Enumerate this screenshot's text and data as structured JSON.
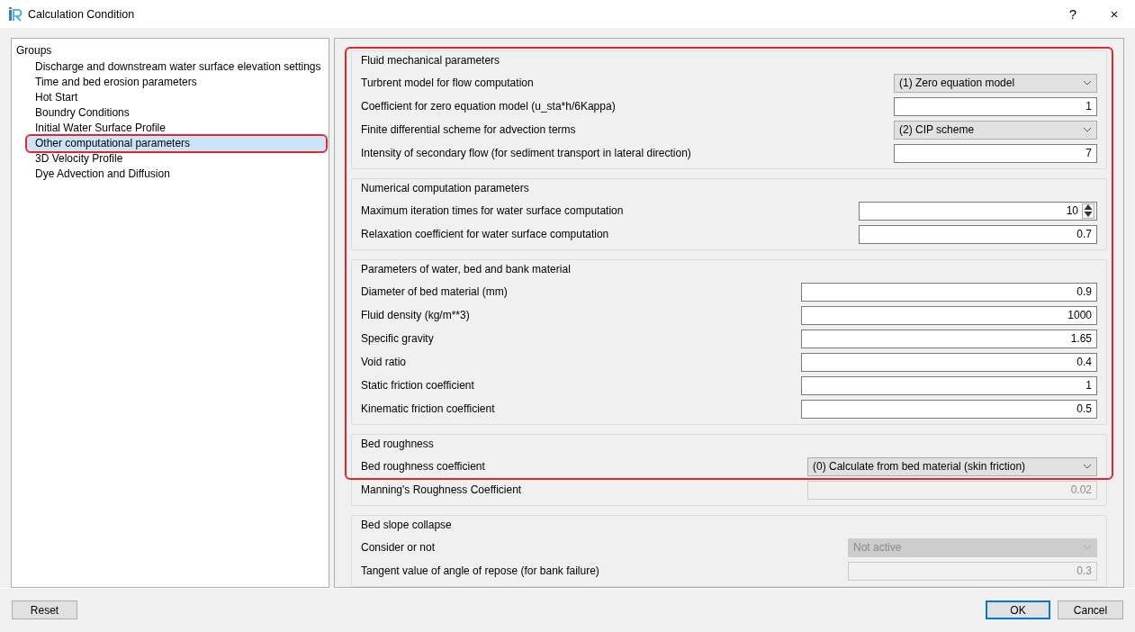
{
  "window": {
    "title": "Calculation Condition",
    "help": "?",
    "close": "×"
  },
  "sidebar": {
    "title": "Groups",
    "items": [
      {
        "label": "Discharge and downstream water surface elevation settings",
        "selected": false
      },
      {
        "label": "Time and bed erosion parameters",
        "selected": false
      },
      {
        "label": "Hot Start",
        "selected": false
      },
      {
        "label": "Boundry Conditions",
        "selected": false
      },
      {
        "label": "Initial Water Surface Profile",
        "selected": false
      },
      {
        "label": "Other computational parameters",
        "selected": true
      },
      {
        "label": "3D Velocity Profile",
        "selected": false
      },
      {
        "label": "Dye Advection and Diffusion",
        "selected": false
      }
    ]
  },
  "groups": [
    {
      "title": "Fluid mechanical parameters",
      "rows": [
        {
          "label": "Turbrent model for flow computation",
          "kind": "combo",
          "value": "(1) Zero equation model",
          "disabled": false
        },
        {
          "label": "Coefficient for zero equation model (u_sta*h/6Kappa)",
          "kind": "text",
          "value": "1",
          "disabled": false
        },
        {
          "label": "Finite differential scheme for advection terms",
          "kind": "combo",
          "value": "(2) CIP scheme",
          "disabled": false
        },
        {
          "label": "Intensity of secondary flow (for sediment transport in lateral direction)",
          "kind": "text",
          "value": "7",
          "disabled": false
        }
      ]
    },
    {
      "title": "Numerical computation parameters",
      "rows": [
        {
          "label": "Maximum iteration times for water surface computation",
          "kind": "spin",
          "value": "10",
          "disabled": false
        },
        {
          "label": "Relaxation coefficient for water surface computation",
          "kind": "text",
          "value": "0.7",
          "disabled": false
        }
      ]
    },
    {
      "title": "Parameters of water, bed and bank material",
      "rows": [
        {
          "label": "Diameter of bed material (mm)",
          "kind": "text",
          "value": "0.9",
          "disabled": false
        },
        {
          "label": "Fluid density (kg/m**3)",
          "kind": "text",
          "value": "1000",
          "disabled": false
        },
        {
          "label": "Specific gravity",
          "kind": "text",
          "value": "1.65",
          "disabled": false
        },
        {
          "label": "Void ratio",
          "kind": "text",
          "value": "0.4",
          "disabled": false
        },
        {
          "label": "Static friction coefficient",
          "kind": "text",
          "value": "1",
          "disabled": false
        },
        {
          "label": "Kinematic friction coefficient",
          "kind": "text",
          "value": "0.5",
          "disabled": false
        }
      ]
    },
    {
      "title": "Bed roughness",
      "rows": [
        {
          "label": "Bed roughness coefficient",
          "kind": "combo",
          "value": "(0) Calculate from bed material (skin friction)",
          "disabled": false
        },
        {
          "label": "Manning's Roughness Coefficient",
          "kind": "text",
          "value": "0.02",
          "disabled": true
        }
      ]
    },
    {
      "title": "Bed slope collapse",
      "rows": [
        {
          "label": "Consider or not",
          "kind": "combo",
          "value": "Not active",
          "disabled": true
        },
        {
          "label": "Tangent value of angle of repose (for bank failure)",
          "kind": "text",
          "value": "0.3",
          "disabled": true
        }
      ]
    }
  ],
  "highlight_outline": true,
  "buttons": {
    "reset": "Reset",
    "ok": "OK",
    "cancel": "Cancel"
  }
}
